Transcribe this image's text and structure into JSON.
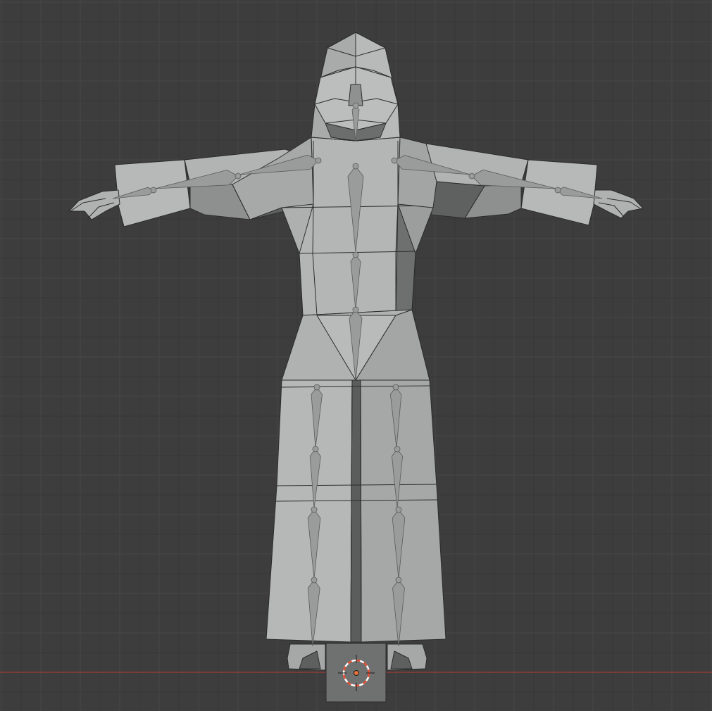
{
  "viewport": {
    "view": "front-orthographic",
    "background_color": "#3d3d3d",
    "grid_minor_color": "#363636",
    "grid_major_color": "#474747",
    "x_axis_color": "#a33b3b"
  },
  "scene": {
    "mesh": {
      "description_icon": "robed-character-mesh",
      "fill_light": "#b7b9b9",
      "fill_mid": "#a9abab",
      "fill_dark": "#6f7070",
      "edge_color": "#2c2c2c"
    },
    "armature": {
      "bone_color": "#9a9c9c",
      "bone_edge": "#5a5a5a"
    },
    "object_origin": {
      "icon": "object-origin-icon",
      "color": "#e9733a"
    },
    "cursor_3d": {
      "icon": "3d-cursor-icon",
      "ring_color_a": "#e34a2f",
      "ring_color_b": "#ffffff"
    }
  }
}
